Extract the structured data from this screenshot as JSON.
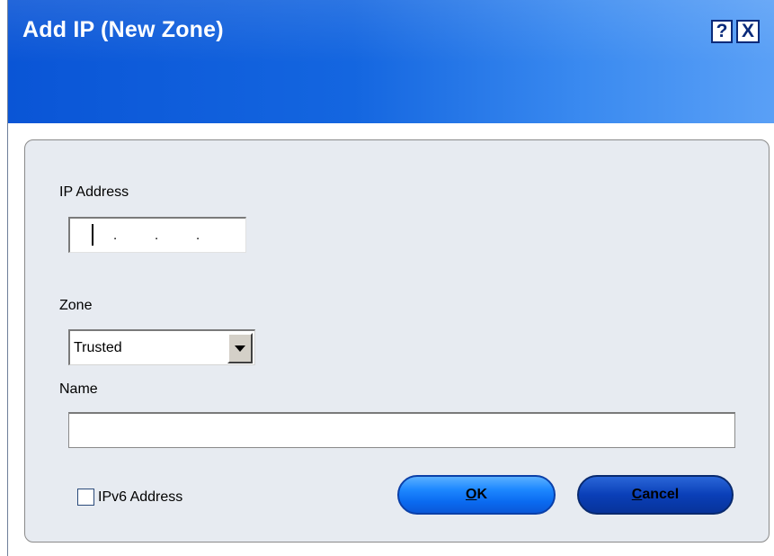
{
  "dialog": {
    "title": "Add IP (New Zone)",
    "help_button": "?",
    "close_button": "X"
  },
  "form": {
    "ip_label": "IP Address",
    "ip_value": "",
    "ip_separators": [
      ".",
      ".",
      "."
    ],
    "zone_label": "Zone",
    "zone_selected": "Trusted",
    "name_label": "Name",
    "name_value": "",
    "ipv6_label": "IPv6 Address",
    "ipv6_checked": false
  },
  "buttons": {
    "ok": {
      "accel": "O",
      "rest": "K"
    },
    "cancel": {
      "accel": "C",
      "rest": "ancel"
    }
  },
  "colors": {
    "title_bar": "#0a55d6",
    "panel_bg": "#e7ebf1",
    "ok_button": "#1e88ff",
    "cancel_button": "#0a3fb8"
  }
}
